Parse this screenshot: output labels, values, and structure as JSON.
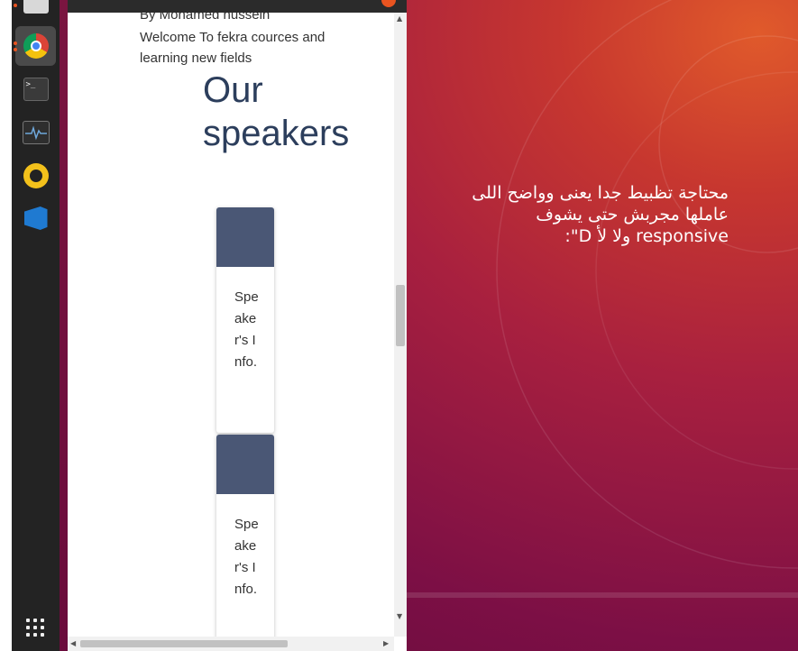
{
  "dock": {
    "items": [
      {
        "name": "files",
        "icon": "files-icon"
      },
      {
        "name": "google-chrome",
        "icon": "chrome-icon",
        "active": true
      },
      {
        "name": "terminal",
        "icon": "terminal-icon",
        "glyph": ">_"
      },
      {
        "name": "system-monitor",
        "icon": "monitor-icon"
      },
      {
        "name": "rhythmbox",
        "icon": "rhythmbox-icon"
      },
      {
        "name": "vs-code",
        "icon": "vscode-icon"
      }
    ],
    "show_apps_icon": "apps-grid-icon"
  },
  "page": {
    "byline": "By Mohamed hussein",
    "welcome": "Welcome To fekra cources and learning new fields",
    "heading": "Our speakers",
    "cards": [
      {
        "text": "Speaker's Info."
      },
      {
        "text": "Speaker's Info."
      }
    ]
  },
  "annotation": {
    "text": "محتاجة تظبيط جدا يعنى وواضح اللى عاملها مجربش حتى يشوف responsive ولا لأ D\":"
  },
  "colors": {
    "accent": "#e95420",
    "card_image": "#4a5775",
    "heading": "#2c3e5c"
  }
}
